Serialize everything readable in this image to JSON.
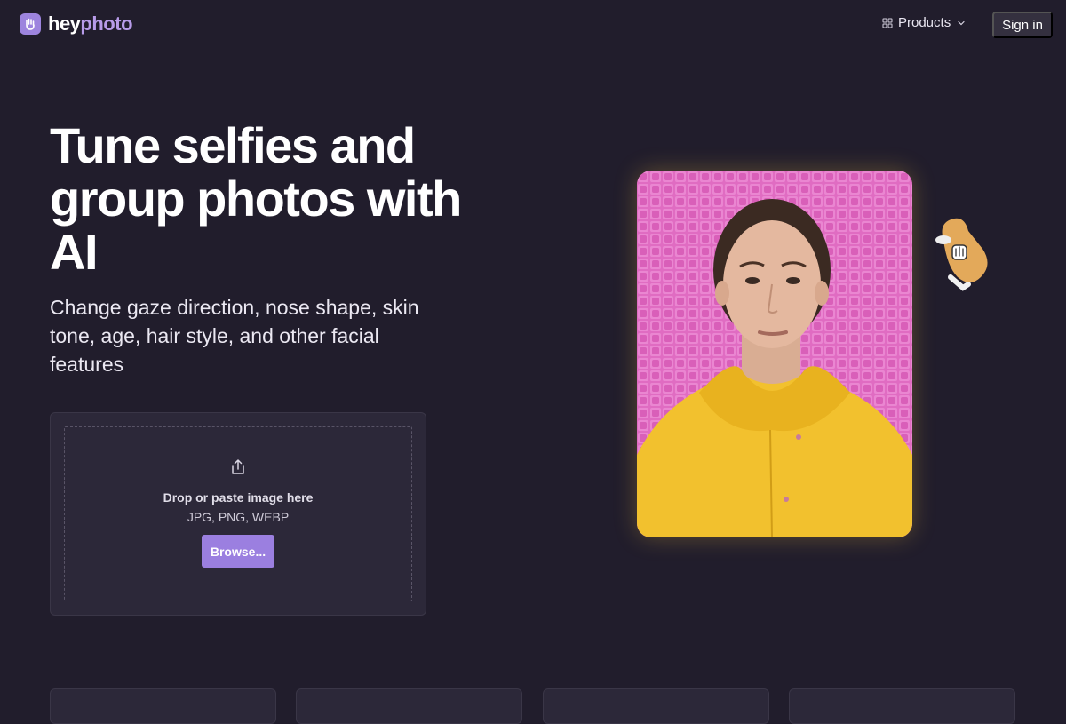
{
  "header": {
    "logo": {
      "part1": "hey",
      "part2": "photo",
      "icon": "hand-icon"
    },
    "nav": {
      "products_label": "Products"
    },
    "signin_label": "Sign in"
  },
  "hero": {
    "title": "Tune selfies and group photos with AI",
    "subtitle": "Change gaze direction, nose shape, skin tone, age, hair style, and other facial features"
  },
  "upload": {
    "icon": "upload-icon",
    "drop_label": "Drop or paste image here",
    "formats": "JPG, PNG, WEBP",
    "browse_label": "Browse..."
  },
  "colors": {
    "background": "#211d2c",
    "accent": "#9b7fe0",
    "logo_accent": "#b79be9",
    "card": "#2c2839",
    "photo_background": "#e26fc4",
    "jacket": "#f2c12e"
  },
  "feature_cards": [
    {
      "id": "feature-card-1"
    },
    {
      "id": "feature-card-2"
    },
    {
      "id": "feature-card-3"
    },
    {
      "id": "feature-card-4"
    }
  ]
}
